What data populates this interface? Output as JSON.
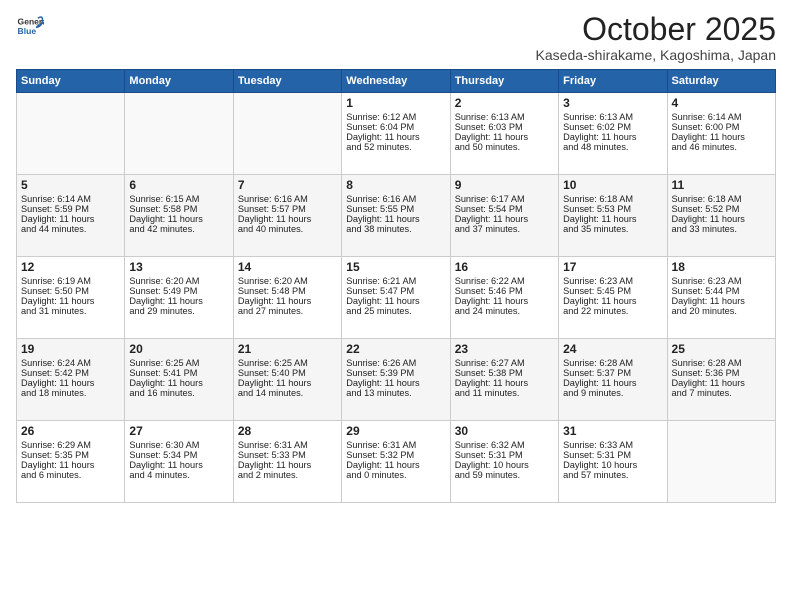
{
  "header": {
    "logo_line1": "General",
    "logo_line2": "Blue",
    "month": "October 2025",
    "location": "Kaseda-shirakame, Kagoshima, Japan"
  },
  "weekdays": [
    "Sunday",
    "Monday",
    "Tuesday",
    "Wednesday",
    "Thursday",
    "Friday",
    "Saturday"
  ],
  "weeks": [
    [
      {
        "day": "",
        "info": ""
      },
      {
        "day": "",
        "info": ""
      },
      {
        "day": "",
        "info": ""
      },
      {
        "day": "1",
        "info": "Sunrise: 6:12 AM\nSunset: 6:04 PM\nDaylight: 11 hours\nand 52 minutes."
      },
      {
        "day": "2",
        "info": "Sunrise: 6:13 AM\nSunset: 6:03 PM\nDaylight: 11 hours\nand 50 minutes."
      },
      {
        "day": "3",
        "info": "Sunrise: 6:13 AM\nSunset: 6:02 PM\nDaylight: 11 hours\nand 48 minutes."
      },
      {
        "day": "4",
        "info": "Sunrise: 6:14 AM\nSunset: 6:00 PM\nDaylight: 11 hours\nand 46 minutes."
      }
    ],
    [
      {
        "day": "5",
        "info": "Sunrise: 6:14 AM\nSunset: 5:59 PM\nDaylight: 11 hours\nand 44 minutes."
      },
      {
        "day": "6",
        "info": "Sunrise: 6:15 AM\nSunset: 5:58 PM\nDaylight: 11 hours\nand 42 minutes."
      },
      {
        "day": "7",
        "info": "Sunrise: 6:16 AM\nSunset: 5:57 PM\nDaylight: 11 hours\nand 40 minutes."
      },
      {
        "day": "8",
        "info": "Sunrise: 6:16 AM\nSunset: 5:55 PM\nDaylight: 11 hours\nand 38 minutes."
      },
      {
        "day": "9",
        "info": "Sunrise: 6:17 AM\nSunset: 5:54 PM\nDaylight: 11 hours\nand 37 minutes."
      },
      {
        "day": "10",
        "info": "Sunrise: 6:18 AM\nSunset: 5:53 PM\nDaylight: 11 hours\nand 35 minutes."
      },
      {
        "day": "11",
        "info": "Sunrise: 6:18 AM\nSunset: 5:52 PM\nDaylight: 11 hours\nand 33 minutes."
      }
    ],
    [
      {
        "day": "12",
        "info": "Sunrise: 6:19 AM\nSunset: 5:50 PM\nDaylight: 11 hours\nand 31 minutes."
      },
      {
        "day": "13",
        "info": "Sunrise: 6:20 AM\nSunset: 5:49 PM\nDaylight: 11 hours\nand 29 minutes."
      },
      {
        "day": "14",
        "info": "Sunrise: 6:20 AM\nSunset: 5:48 PM\nDaylight: 11 hours\nand 27 minutes."
      },
      {
        "day": "15",
        "info": "Sunrise: 6:21 AM\nSunset: 5:47 PM\nDaylight: 11 hours\nand 25 minutes."
      },
      {
        "day": "16",
        "info": "Sunrise: 6:22 AM\nSunset: 5:46 PM\nDaylight: 11 hours\nand 24 minutes."
      },
      {
        "day": "17",
        "info": "Sunrise: 6:23 AM\nSunset: 5:45 PM\nDaylight: 11 hours\nand 22 minutes."
      },
      {
        "day": "18",
        "info": "Sunrise: 6:23 AM\nSunset: 5:44 PM\nDaylight: 11 hours\nand 20 minutes."
      }
    ],
    [
      {
        "day": "19",
        "info": "Sunrise: 6:24 AM\nSunset: 5:42 PM\nDaylight: 11 hours\nand 18 minutes."
      },
      {
        "day": "20",
        "info": "Sunrise: 6:25 AM\nSunset: 5:41 PM\nDaylight: 11 hours\nand 16 minutes."
      },
      {
        "day": "21",
        "info": "Sunrise: 6:25 AM\nSunset: 5:40 PM\nDaylight: 11 hours\nand 14 minutes."
      },
      {
        "day": "22",
        "info": "Sunrise: 6:26 AM\nSunset: 5:39 PM\nDaylight: 11 hours\nand 13 minutes."
      },
      {
        "day": "23",
        "info": "Sunrise: 6:27 AM\nSunset: 5:38 PM\nDaylight: 11 hours\nand 11 minutes."
      },
      {
        "day": "24",
        "info": "Sunrise: 6:28 AM\nSunset: 5:37 PM\nDaylight: 11 hours\nand 9 minutes."
      },
      {
        "day": "25",
        "info": "Sunrise: 6:28 AM\nSunset: 5:36 PM\nDaylight: 11 hours\nand 7 minutes."
      }
    ],
    [
      {
        "day": "26",
        "info": "Sunrise: 6:29 AM\nSunset: 5:35 PM\nDaylight: 11 hours\nand 6 minutes."
      },
      {
        "day": "27",
        "info": "Sunrise: 6:30 AM\nSunset: 5:34 PM\nDaylight: 11 hours\nand 4 minutes."
      },
      {
        "day": "28",
        "info": "Sunrise: 6:31 AM\nSunset: 5:33 PM\nDaylight: 11 hours\nand 2 minutes."
      },
      {
        "day": "29",
        "info": "Sunrise: 6:31 AM\nSunset: 5:32 PM\nDaylight: 11 hours\nand 0 minutes."
      },
      {
        "day": "30",
        "info": "Sunrise: 6:32 AM\nSunset: 5:31 PM\nDaylight: 10 hours\nand 59 minutes."
      },
      {
        "day": "31",
        "info": "Sunrise: 6:33 AM\nSunset: 5:31 PM\nDaylight: 10 hours\nand 57 minutes."
      },
      {
        "day": "",
        "info": ""
      }
    ]
  ]
}
